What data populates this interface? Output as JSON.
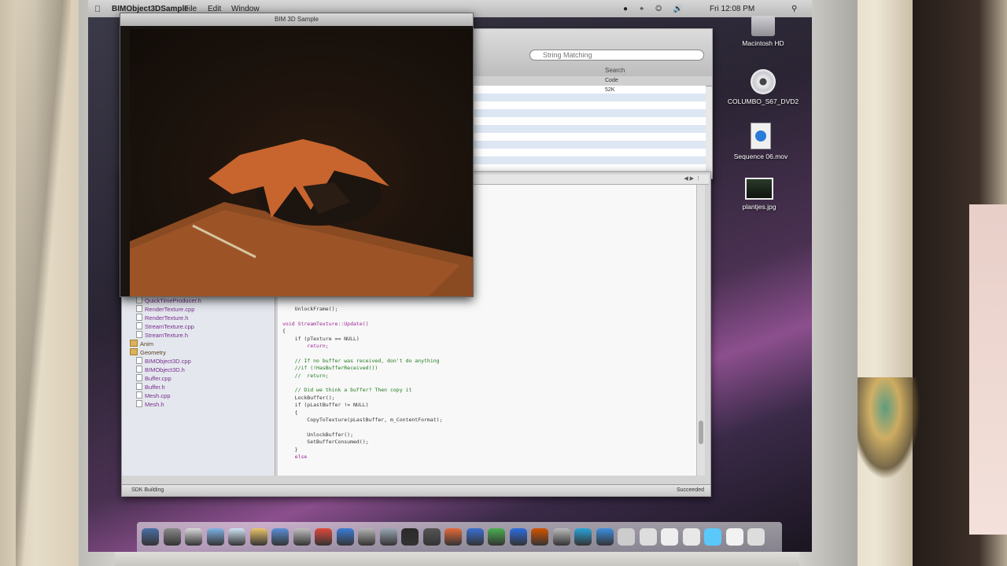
{
  "menubar": {
    "app_name": "BIMObject3DSample",
    "file": "File",
    "edit": "Edit",
    "window": "Window",
    "clock": "Fri 12:08 PM"
  },
  "desktop": {
    "icons": [
      {
        "label": "Macintosh HD",
        "icon": "hard-drive-icon"
      },
      {
        "label": "COLUMBO_S67_DVD2",
        "icon": "dvd-icon"
      },
      {
        "label": "Sequence 06.mov",
        "icon": "quicktime-movie-icon"
      },
      {
        "label": "plantjes.jpg",
        "icon": "image-file-icon"
      }
    ]
  },
  "find_window": {
    "search_placeholder": "String Matching",
    "search_label": "Search",
    "columns": [
      "Code"
    ],
    "first_row_code": "52K"
  },
  "render_window": {
    "title": "BIM 3D Sample"
  },
  "xcode": {
    "sidebar": {
      "files_top": [
        {
          "label": "QuickTimeProducer.h",
          "group": false
        },
        {
          "label": "RenderTexture.cpp",
          "group": false
        },
        {
          "label": "RenderTexture.h",
          "group": false
        },
        {
          "label": "StreamTexture.cpp",
          "group": false
        },
        {
          "label": "StreamTexture.h",
          "group": false
        },
        {
          "label": "Anim",
          "group": true
        },
        {
          "label": "Geometry",
          "group": true
        },
        {
          "label": "BIMObject3D.cpp",
          "group": false
        },
        {
          "label": "BIMObject3D.h",
          "group": false
        },
        {
          "label": "Buffer.cpp",
          "group": false
        },
        {
          "label": "Buffer.h",
          "group": false
        },
        {
          "label": "Mesh.cpp",
          "group": false
        },
        {
          "label": "Mesh.h",
          "group": false
        }
      ]
    },
    "code_lines": [
      {
        "text": "    UnlockFrame();",
        "kind": "normal"
      },
      {
        "text": "",
        "kind": "normal"
      },
      {
        "text": "void StreamTexture::Update()",
        "kind": "kw"
      },
      {
        "text": "{",
        "kind": "normal"
      },
      {
        "text": "    if (pTexture == NULL)",
        "kind": "normal"
      },
      {
        "text": "        return;",
        "kind": "kw"
      },
      {
        "text": "",
        "kind": "normal"
      },
      {
        "text": "    // If no buffer was received, don't do anything",
        "kind": "comment"
      },
      {
        "text": "    //if (!HasBufferReceived())",
        "kind": "comment"
      },
      {
        "text": "    //  return;",
        "kind": "comment"
      },
      {
        "text": "",
        "kind": "normal"
      },
      {
        "text": "    // Did we think a buffer? Then copy it",
        "kind": "comment"
      },
      {
        "text": "    LockBuffer();",
        "kind": "normal"
      },
      {
        "text": "    if (pLastBuffer != NULL)",
        "kind": "normal"
      },
      {
        "text": "    {",
        "kind": "normal"
      },
      {
        "text": "        CopyToTexture(pLastBuffer, m_ContentFormat);",
        "kind": "normal"
      },
      {
        "text": "",
        "kind": "normal"
      },
      {
        "text": "        UnlockBuffer();",
        "kind": "normal"
      },
      {
        "text": "        SetBufferConsumed();",
        "kind": "normal"
      },
      {
        "text": "    }",
        "kind": "normal"
      },
      {
        "text": "    else",
        "kind": "kw"
      }
    ],
    "build_status": "SDK Building",
    "result": "Succeeded"
  },
  "colors": {
    "accent": "#2b7bd8",
    "wallpaper_purple": "#8c4f8e"
  }
}
